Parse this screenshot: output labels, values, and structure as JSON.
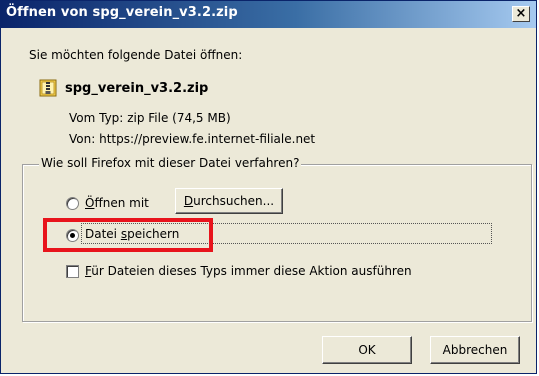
{
  "window": {
    "title": "Öffnen von spg_verein_v3.2.zip",
    "close_glyph": "×"
  },
  "prompt": "Sie möchten folgende Datei öffnen:",
  "file": {
    "icon": "zip-file-icon",
    "name": "spg_verein_v3.2.zip",
    "type_label": "Vom Typ:",
    "type_value": "zip File (74,5 MB)",
    "from_label": "Von:",
    "from_value": "https://preview.fe.internet-filiale.net"
  },
  "action_group": {
    "legend": "Wie soll Firefox mit dieser Datei verfahren?",
    "open_with": {
      "label_u": "Ö",
      "label_rest": "ffnen mit",
      "selected": false
    },
    "browse_button": {
      "label_u": "D",
      "label_rest": "urchsuchen..."
    },
    "save_file": {
      "label_pre": "Datei ",
      "label_u": "s",
      "label_rest": "peichern",
      "selected": true
    },
    "always_do": {
      "label_u": "F",
      "label_rest": "ür Dateien dieses Typs immer diese Aktion ausführen",
      "checked": false
    }
  },
  "buttons": {
    "ok": "OK",
    "cancel": "Abbrechen"
  },
  "colors": {
    "title_bar": "#0a246a",
    "dialog_bg": "#ece9d8",
    "highlight": "#e8141c"
  }
}
